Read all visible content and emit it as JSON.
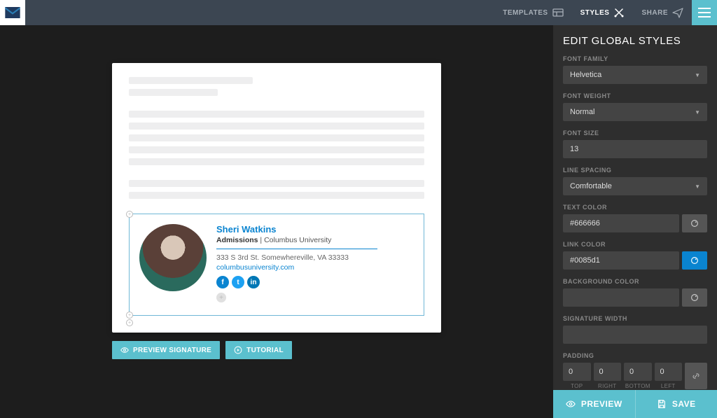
{
  "topbar": {
    "templates": "TEMPLATES",
    "styles": "STYLES",
    "share": "SHARE"
  },
  "canvas": {
    "preview_signature": "PREVIEW SIGNATURE",
    "tutorial": "TUTORIAL",
    "signature": {
      "name": "Sheri Watkins",
      "role_bold": "Admissions",
      "role_sep": " | ",
      "role_rest": "Columbus University",
      "address": "333 S 3rd St. Somewhereville, VA 33333",
      "link": "columbusuniversity.com",
      "socials": [
        "f",
        "t",
        "in"
      ]
    }
  },
  "panel": {
    "title": "EDIT GLOBAL STYLES",
    "font_family_label": "FONT FAMILY",
    "font_family_value": "Helvetica",
    "font_weight_label": "FONT WEIGHT",
    "font_weight_value": "Normal",
    "font_size_label": "FONT SIZE",
    "font_size_value": "13",
    "line_spacing_label": "LINE SPACING",
    "line_spacing_value": "Comfortable",
    "text_color_label": "TEXT COLOR",
    "text_color_value": "#666666",
    "link_color_label": "LINK COLOR",
    "link_color_value": "#0085d1",
    "background_color_label": "BACKGROUND COLOR",
    "background_color_value": "",
    "signature_width_label": "SIGNATURE WIDTH",
    "signature_width_value": "",
    "padding_label": "PADDING",
    "padding": {
      "top": "0",
      "right": "0",
      "bottom": "0",
      "left": "0"
    },
    "pad_labels": {
      "top": "TOP",
      "right": "RIGHT",
      "bottom": "BOTTOM",
      "left": "LEFT"
    },
    "footer_preview": "PREVIEW",
    "footer_save": "SAVE"
  }
}
